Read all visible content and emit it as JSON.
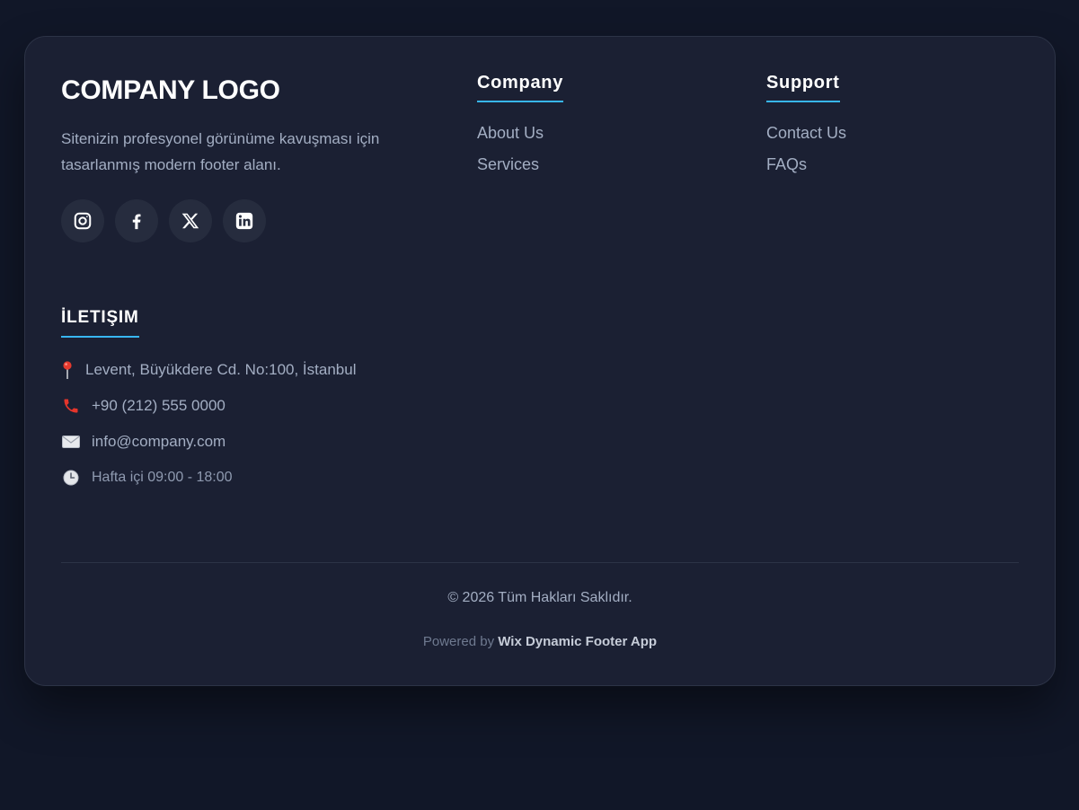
{
  "brand": {
    "logo_text": "COMPANY LOGO",
    "description": "Sitenizin profesyonel görünüme kavuşması için tasarlanmış modern footer alanı."
  },
  "social": [
    {
      "name": "instagram",
      "icon": "instagram-icon"
    },
    {
      "name": "facebook",
      "icon": "facebook-icon"
    },
    {
      "name": "x",
      "icon": "x-icon"
    },
    {
      "name": "linkedin",
      "icon": "linkedin-icon"
    }
  ],
  "contact": {
    "heading": "İLETIŞIM",
    "address": "Levent, Büyükdere Cd. No:100, İstanbul",
    "phone": "+90 (212) 555 0000",
    "email": "info@company.com",
    "hours": "Hafta içi 09:00 - 18:00"
  },
  "columns": [
    {
      "heading": "Company",
      "links": [
        "About Us",
        "Services"
      ]
    },
    {
      "heading": "Support",
      "links": [
        "Contact Us",
        "FAQs"
      ]
    }
  ],
  "bottom": {
    "copyright": "© 2026 Tüm Hakları Saklıdır.",
    "powered_prefix": "Powered by",
    "powered_app": "Wix Dynamic Footer App"
  },
  "colors": {
    "page_background": "#111728",
    "card_background": "#1b2033",
    "accent": "#38b6f0",
    "text_muted": "#a3aec3",
    "heading": "#ffffff"
  }
}
